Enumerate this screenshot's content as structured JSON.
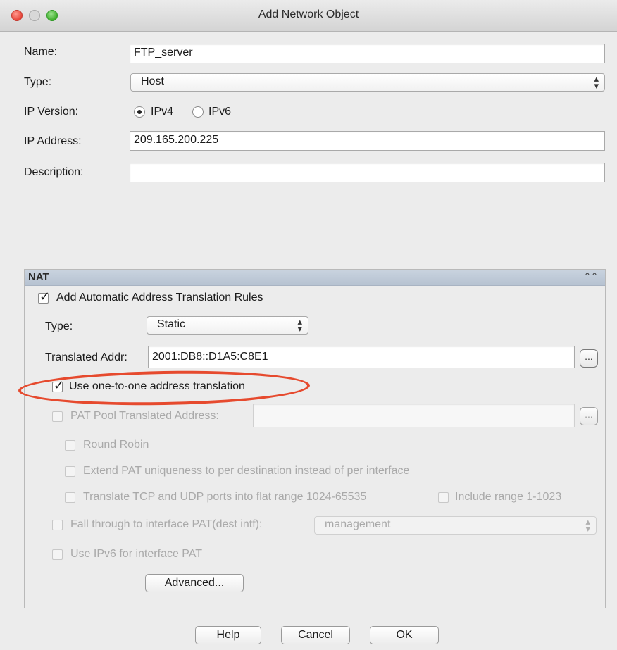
{
  "window": {
    "title": "Add Network Object"
  },
  "form": {
    "name_label": "Name:",
    "name_value": "FTP_server",
    "type_label": "Type:",
    "type_value": "Host",
    "ip_version_label": "IP Version:",
    "ipv4_label": "IPv4",
    "ipv6_label": "IPv6",
    "ip_version_selected": "IPv4",
    "ip_address_label": "IP Address:",
    "ip_address_value": "209.165.200.225",
    "description_label": "Description:",
    "description_value": ""
  },
  "nat": {
    "title": "NAT",
    "add_auto_rules_label": "Add Automatic Address Translation Rules",
    "add_auto_rules_checked": true,
    "type_label": "Type:",
    "type_value": "Static",
    "translated_addr_label": "Translated Addr:",
    "translated_addr_value": "2001:DB8::D1A5:C8E1",
    "browse_button_label": "...",
    "one_to_one_label": "Use one-to-one address translation",
    "one_to_one_checked": true,
    "pat_pool_label": "PAT Pool Translated Address:",
    "pat_pool_value": "",
    "round_robin_label": "Round Robin",
    "extend_pat_label": "Extend PAT uniqueness to per destination instead of per interface",
    "translate_ports_label": "Translate TCP and UDP ports into flat range 1024-65535",
    "include_range_label": "Include range 1-1023",
    "fall_through_label": "Fall through to interface PAT(dest intf):",
    "fall_through_value": "management",
    "use_ipv6_label": "Use IPv6 for interface PAT",
    "advanced_label": "Advanced..."
  },
  "footer": {
    "help_label": "Help",
    "cancel_label": "Cancel",
    "ok_label": "OK"
  },
  "colors": {
    "highlight_ring": "#e64a2e",
    "nat_header": "#c9d3df"
  }
}
